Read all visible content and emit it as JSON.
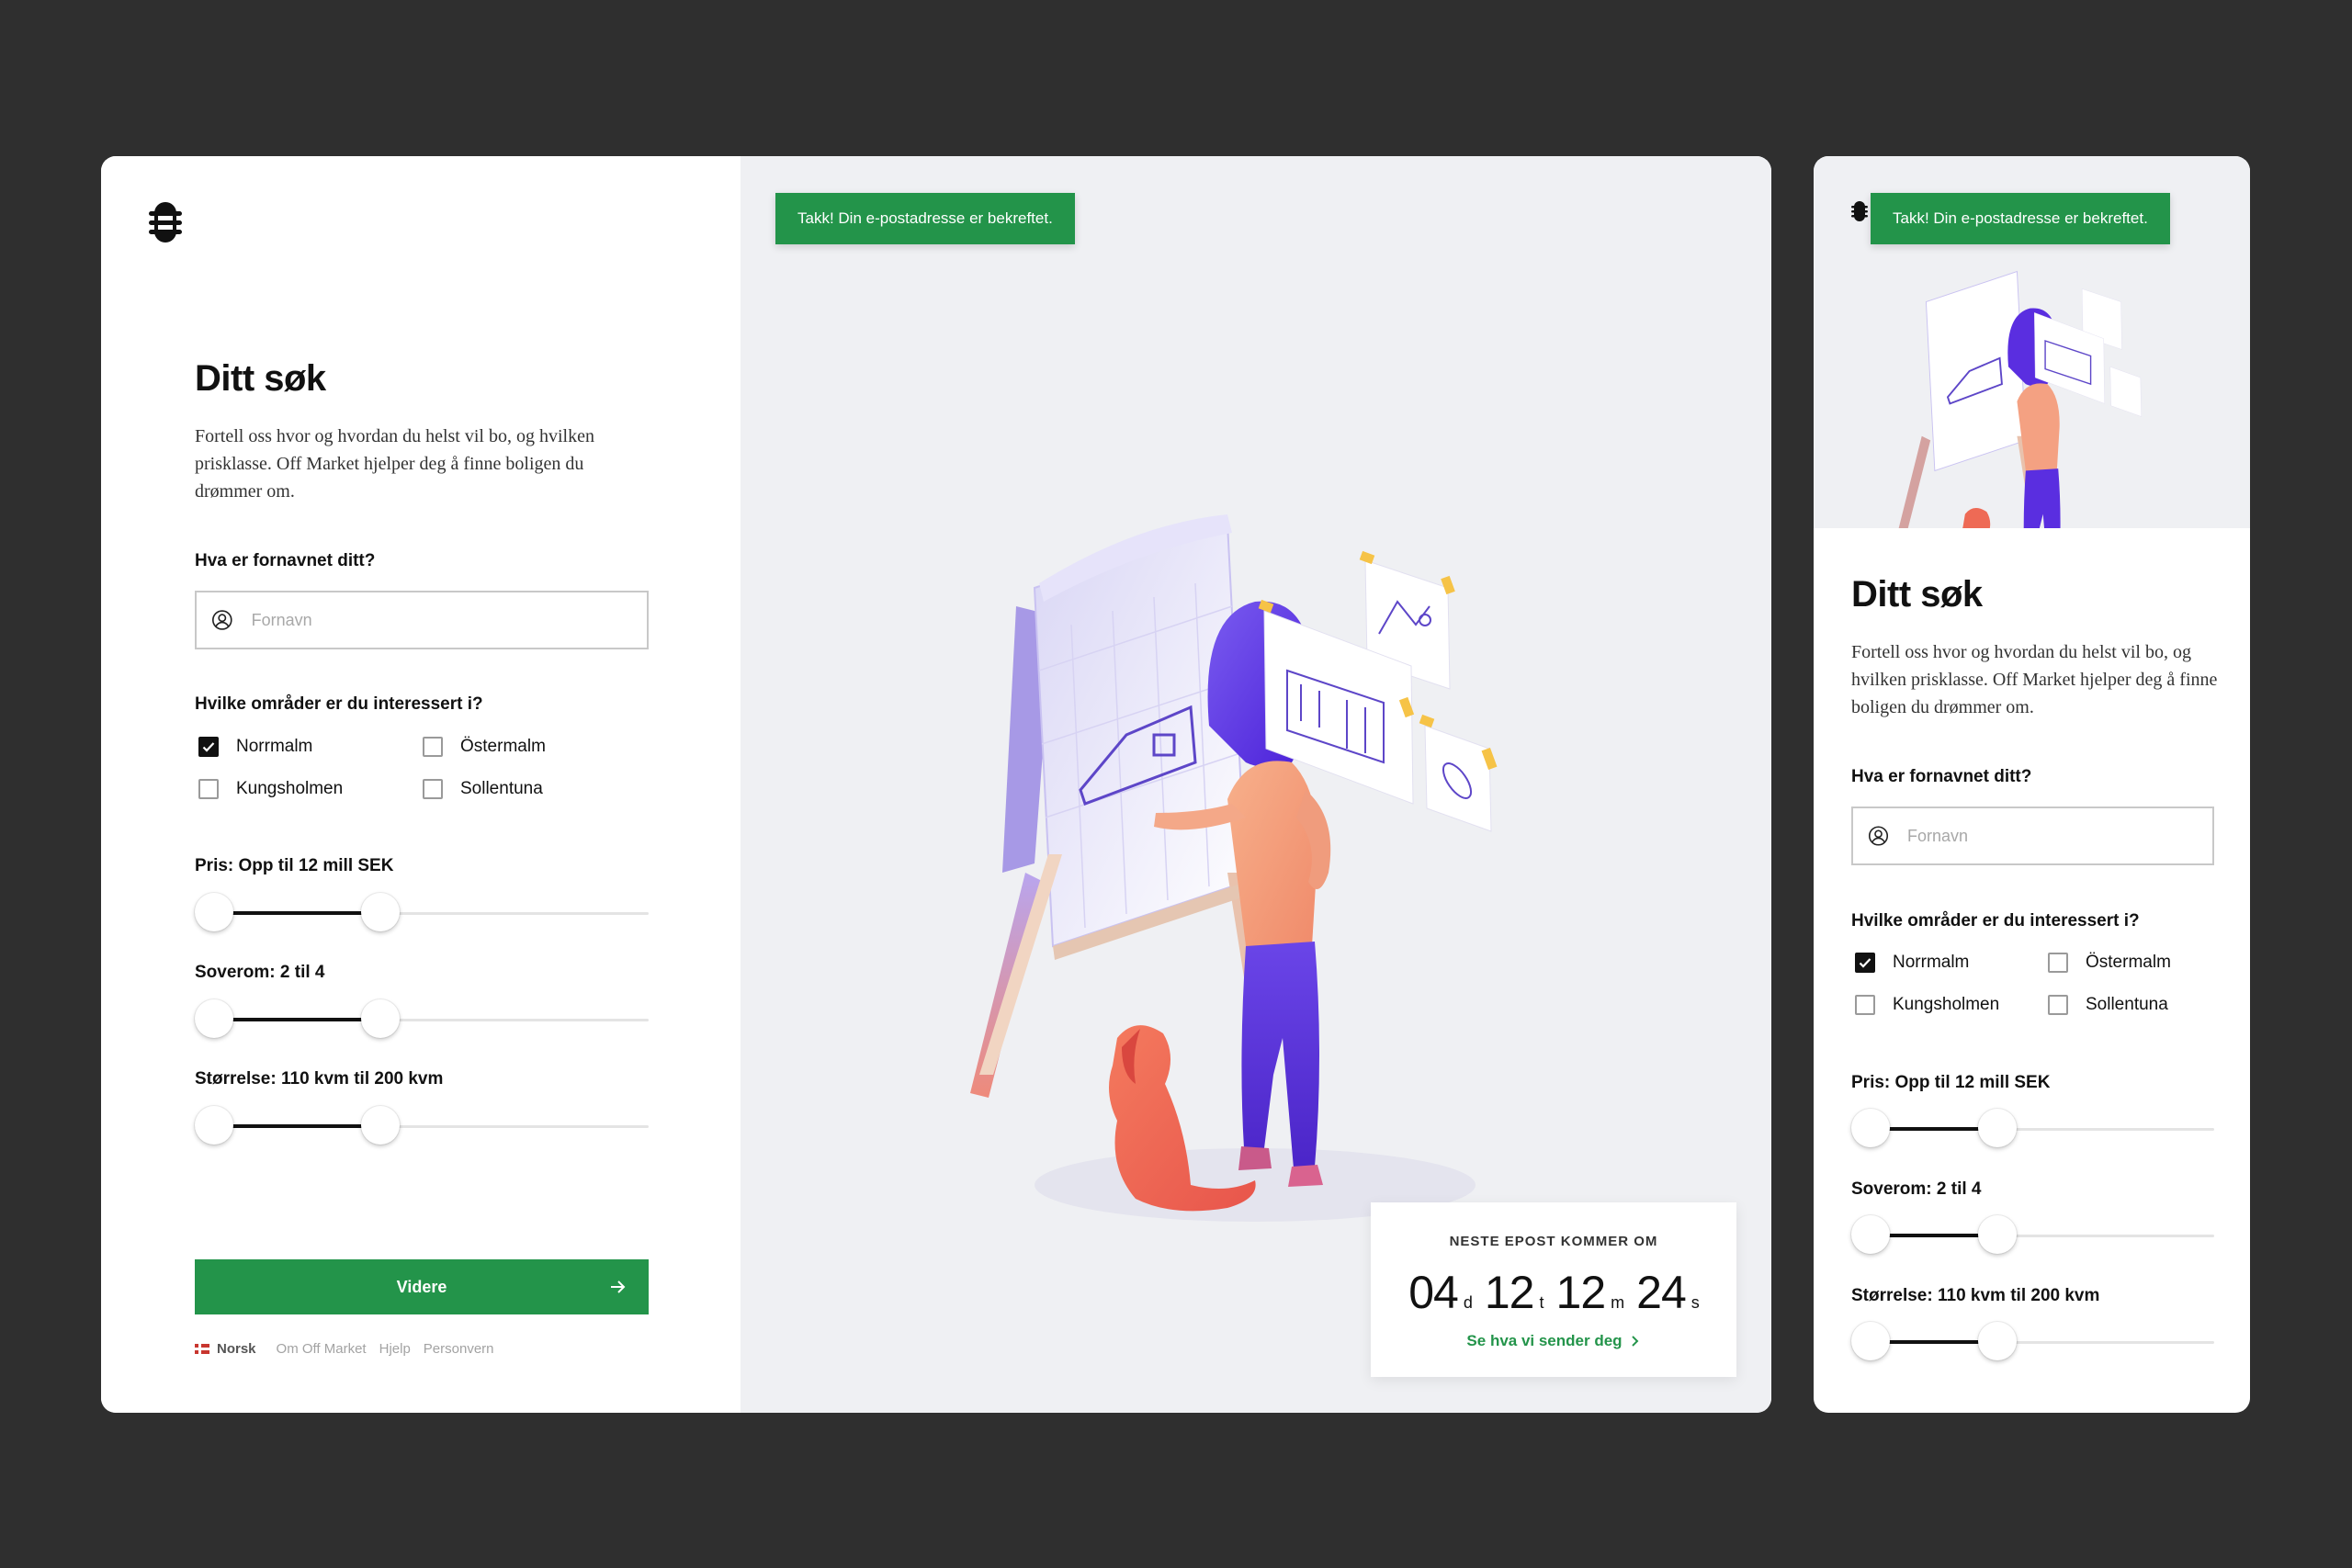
{
  "colors": {
    "background": "#2f2f2f",
    "brand_green": "#23944a",
    "hero_bg": "#eff0f3",
    "purple": "#5a2ee0",
    "coral": "#ee6a55"
  },
  "icons": {
    "logo": "off-market-logo",
    "field": "user-circle-icon",
    "button": "arrow-right-icon",
    "link": "chevron-right-icon"
  },
  "toast": {
    "message": "Takk! Din e-postadresse er bekreftet."
  },
  "form": {
    "title": "Ditt søk",
    "description": "Fortell oss hvor og hvordan du helst vil bo, og hvilken prisklasse. Off Market hjelper deg å finne boligen du drømmer om.",
    "name_question": "Hva er fornavnet ditt?",
    "name_placeholder": "Fornavn",
    "name_value": "",
    "areas_question": "Hvilke områder er du interessert i?",
    "areas": [
      {
        "label": "Norrmalm",
        "checked": true
      },
      {
        "label": "Östermalm",
        "checked": false
      },
      {
        "label": "Kungsholmen",
        "checked": false
      },
      {
        "label": "Sollentuna",
        "checked": false
      }
    ],
    "sliders": [
      {
        "label": "Pris: Opp til 12 mill SEK",
        "low": 0,
        "high": 0.4
      },
      {
        "label": "Soverom: 2 til 4",
        "low": 0,
        "high": 0.4
      },
      {
        "label": "Størrelse: 110 kvm til 200 kvm",
        "low": 0,
        "high": 0.4
      }
    ],
    "mobile_sliders": [
      {
        "label": "Pris: Opp til 12 mill SEK",
        "low": 0,
        "high": 0.39
      },
      {
        "label": "Soverom: 2 til 4",
        "low": 0,
        "high": 0.39
      },
      {
        "label": "Størrelse: 110 kvm til 200 kvm",
        "low": 0,
        "high": 0.39
      }
    ],
    "submit_label": "Videre"
  },
  "footer": {
    "language": "Norsk",
    "links": [
      "Om Off Market",
      "Hjelp",
      "Personvern"
    ]
  },
  "countdown": {
    "label": "NESTE EPOST KOMMER OM",
    "days": "04",
    "days_unit": "d",
    "hours": "12",
    "hours_unit": "t",
    "minutes": "12",
    "minutes_unit": "m",
    "seconds": "24",
    "seconds_unit": "s",
    "link": "Se hva vi sender deg"
  }
}
